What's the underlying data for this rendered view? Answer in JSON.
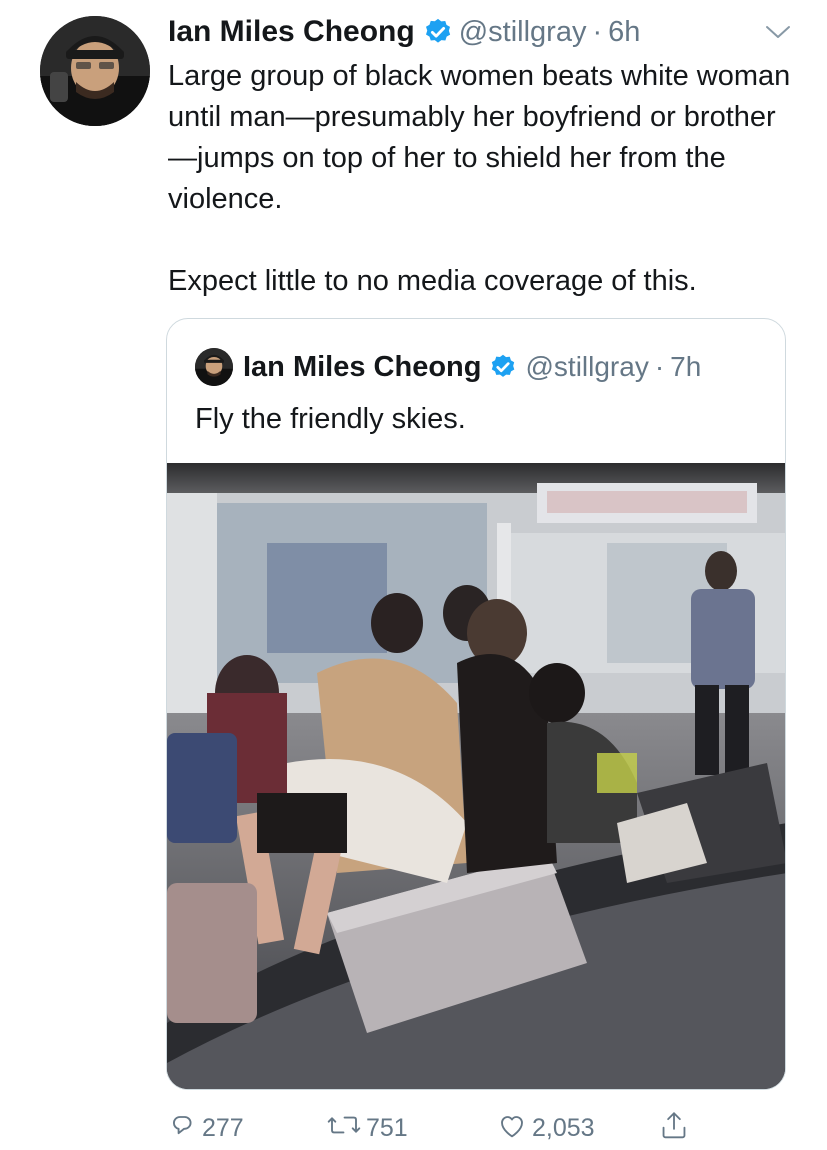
{
  "tweet": {
    "author_name": "Ian Miles Cheong",
    "handle": "@stillgray",
    "separator": "·",
    "time": "6h",
    "text_paragraph_1": "Large group of black women beats white woman until man—presumably her boyfriend or brother—jumps on top of her to shield her from the violence.",
    "text_paragraph_2": "Expect little to no media coverage of this."
  },
  "quoted_tweet": {
    "author_name": "Ian Miles Cheong",
    "handle": "@stillgray",
    "separator": "·",
    "time": "7h",
    "text": "Fly the friendly skies."
  },
  "actions": {
    "reply_count": "277",
    "retweet_count": "751",
    "like_count": "2,053"
  },
  "icons": {
    "verified": "verified-badge-icon",
    "caret": "chevron-down-icon",
    "reply": "reply-icon",
    "retweet": "retweet-icon",
    "like": "heart-icon",
    "share": "share-icon"
  },
  "colors": {
    "verified_blue": "#1da1f2",
    "secondary_text": "#657786",
    "primary_text": "#14171a",
    "border": "#cfd9de"
  }
}
